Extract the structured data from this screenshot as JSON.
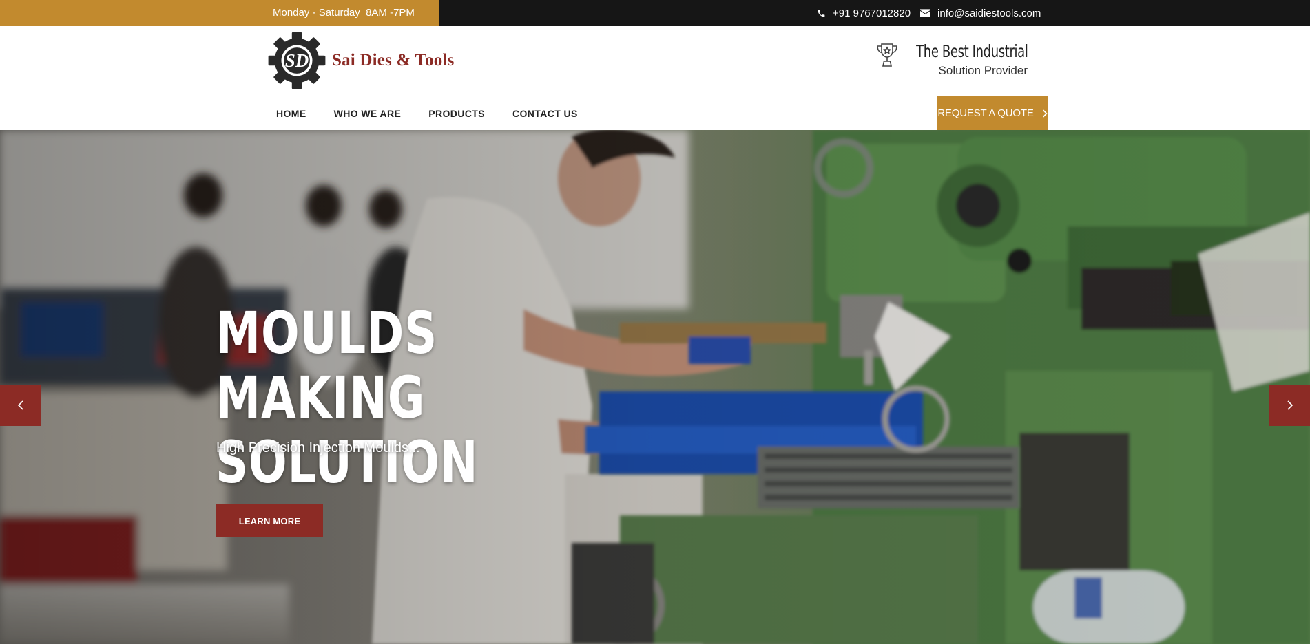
{
  "topbar": {
    "hours": "Monday - Saturday  8AM -7PM",
    "phone": "+91 9767012820",
    "email": "info@saidiestools.com",
    "phone_icon": "phone-icon",
    "email_icon": "envelope-icon"
  },
  "header": {
    "logo_text": "Sai Dies & Tools",
    "logo_monogram": "SD",
    "award_icon": "trophy-icon",
    "tagline_title": "The Best Industrial",
    "tagline_sub": "Solution Provider"
  },
  "nav": {
    "items": [
      "HOME",
      "WHO WE ARE",
      "PRODUCTS",
      "CONTACT US"
    ],
    "quote_label": "REQUEST A QUOTE"
  },
  "hero": {
    "title_line1": "MOULDS MAKING",
    "title_line2": "SOLUTION",
    "subtitle": "High Precision Injection Moulds...",
    "button_label": "LEARN MORE",
    "prev_icon": "chevron-left-icon",
    "next_icon": "chevron-right-icon"
  },
  "colors": {
    "accent_gold": "#c28a2e",
    "brand_red": "#8c2b25",
    "topbar_dark": "#161616"
  }
}
